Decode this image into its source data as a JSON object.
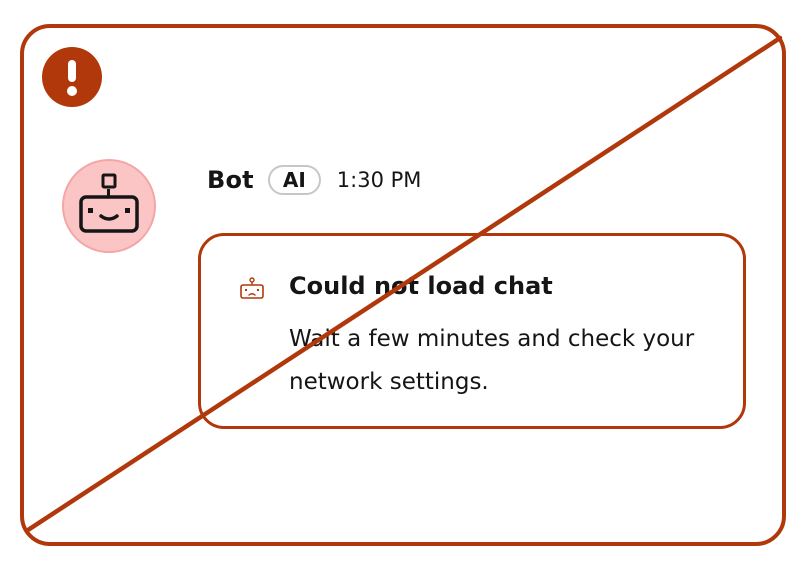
{
  "status": {
    "alert_icon": "exclamation-icon",
    "accent_color": "#b1380b"
  },
  "message": {
    "avatar_icon": "robot-icon",
    "avatar_color": "#fbc5c5",
    "sender": "Bot",
    "badge": "AI",
    "timestamp": "1:30 PM"
  },
  "error_card": {
    "icon": "robot-error-icon",
    "title": "Could not load chat",
    "body": "Wait a few minutes and check your network settings."
  }
}
